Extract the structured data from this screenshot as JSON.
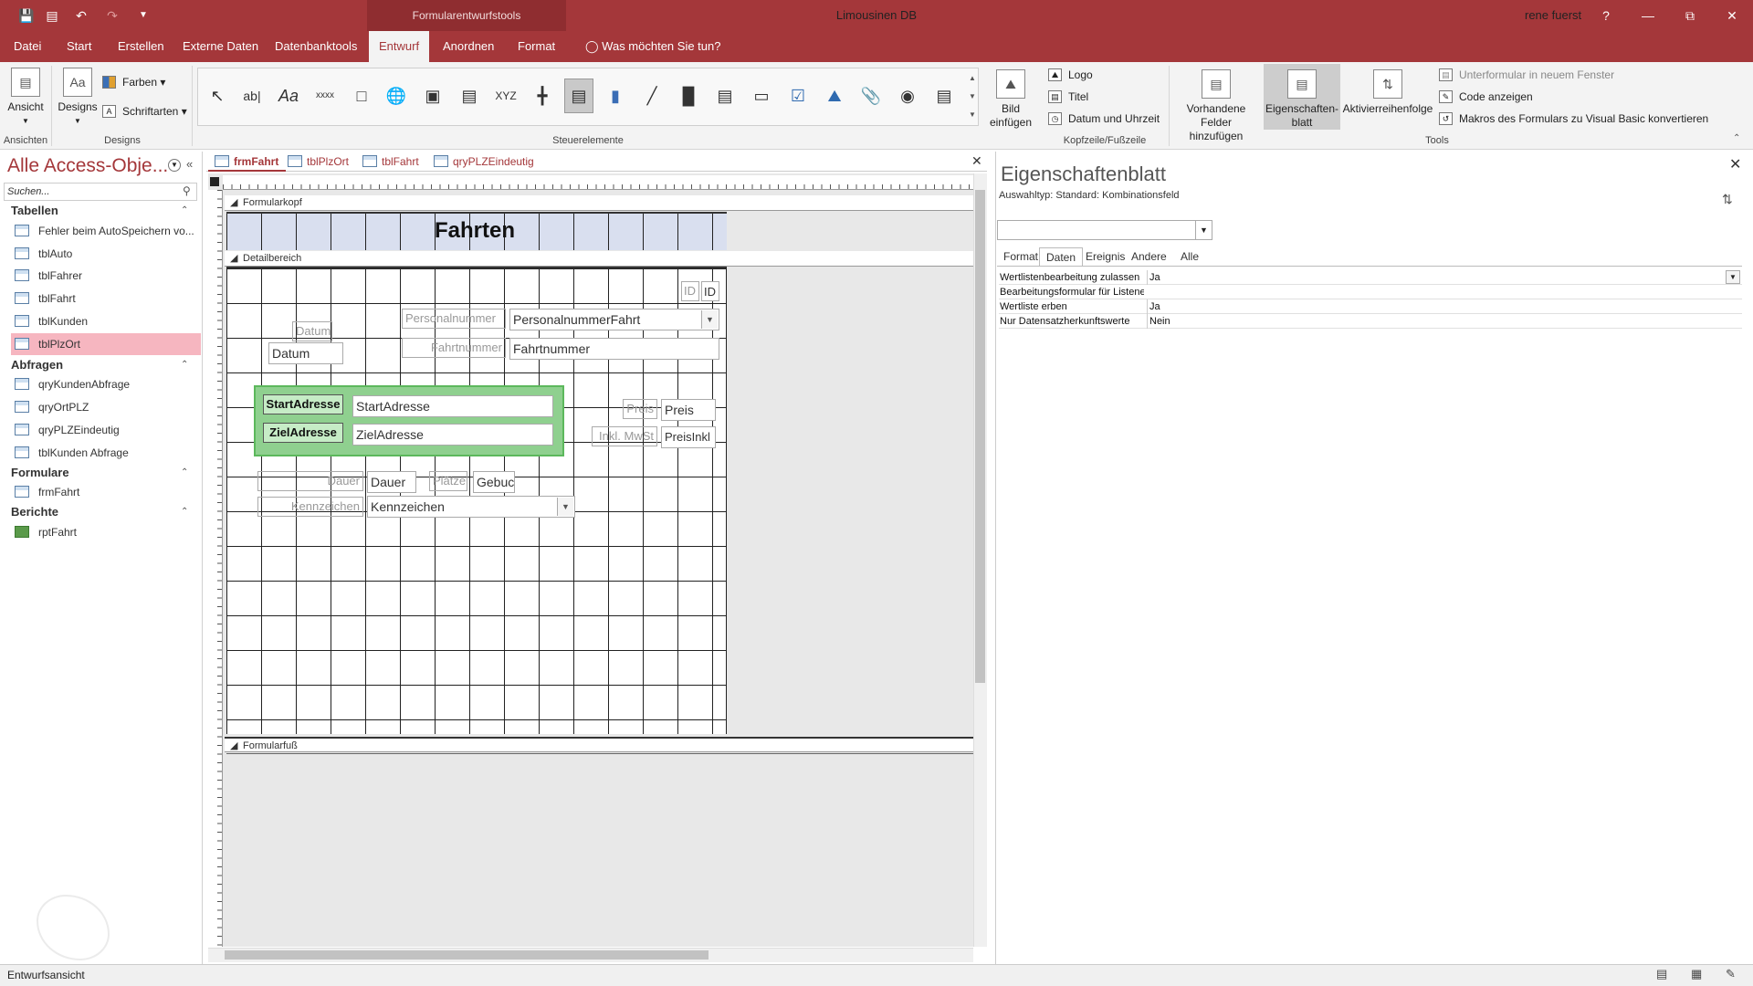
{
  "app": {
    "context_tab": "Formularentwurfstools",
    "title": "Limousinen DB",
    "user": "rene fuerst",
    "help": "?"
  },
  "ribbon_tabs": [
    "Datei",
    "Start",
    "Erstellen",
    "Externe Daten",
    "Datenbanktools",
    "Entwurf",
    "Anordnen",
    "Format"
  ],
  "tell_me": "Was möchten Sie tun?",
  "ribbon": {
    "ansicht": "Ansicht",
    "ansichten_group": "Ansichten",
    "designs": "Designs",
    "farben": "Farben",
    "schriftarten": "Schriftarten",
    "designs_group": "Designs",
    "steuerelemente_group": "Steuerelemente",
    "controls_xyz": "XYZ",
    "controls_abl": "ab|",
    "controls_aa": "Aa",
    "controls_xxxx": "xxxx",
    "bild_einfuegen_1": "Bild",
    "bild_einfuegen_2": "einfügen",
    "logo": "Logo",
    "titel": "Titel",
    "datum_uhrzeit": "Datum und Uhrzeit",
    "kopfzeile_group": "Kopfzeile/Fußzeile",
    "vorhandene_1": "Vorhandene",
    "vorhandene_2": "Felder hinzufügen",
    "eigenschaften_1": "Eigenschaften-",
    "eigenschaften_2": "blatt",
    "aktivierung": "Aktivierreihenfolge",
    "unterformular": "Unterformular in neuem Fenster",
    "code_anzeigen": "Code anzeigen",
    "makros": "Makros des Formulars zu Visual Basic konvertieren",
    "tools_group": "Tools"
  },
  "nav": {
    "title": "Alle Access-Obje...",
    "search_placeholder": "Suchen...",
    "sections": [
      {
        "label": "Tabellen",
        "items": [
          "Fehler beim AutoSpeichern vo...",
          "tblAuto",
          "tblFahrer",
          "tblFahrt",
          "tblKunden",
          "tblPlzOrt"
        ]
      },
      {
        "label": "Abfragen",
        "items": [
          "qryKundenAbfrage",
          "qryOrtPLZ",
          "qryPLZEindeutig",
          "tblKunden Abfrage"
        ]
      },
      {
        "label": "Formulare",
        "items": [
          "frmFahrt"
        ]
      },
      {
        "label": "Berichte",
        "items": [
          "rptFahrt"
        ]
      }
    ]
  },
  "doc_tabs": [
    "frmFahrt",
    "tblPlzOrt",
    "tblFahrt",
    "qryPLZEindeutig"
  ],
  "design": {
    "sec_header": "Formularkopf",
    "sec_detail": "Detailbereich",
    "sec_footer": "Formularfuß",
    "form_title": "Fahrten",
    "id_label": "ID",
    "id_field": "ID",
    "datum_label": "Datum",
    "datum_field": "Datum",
    "personal_label": "Personalnummer",
    "personal_field": "PersonalnummerFahrt",
    "fahrt_label": "Fahrtnummer",
    "fahrt_field": "Fahrtnummer",
    "start_label": "StartAdresse",
    "start_field": "StartAdresse",
    "ziel_label": "ZielAdresse",
    "ziel_field": "ZielAdresse",
    "preis_label": "Preis",
    "preis_field": "Preis",
    "inkl_label": "Inkl. MwSt",
    "inkl_field": "PreisInkl",
    "dauer_label": "Dauer",
    "dauer_field": "Dauer",
    "plaetze_label": "Plätze",
    "gebucht_field": "Gebucl",
    "kennzeichen_label": "Kennzeichen",
    "kennzeichen_field": "Kennzeichen"
  },
  "props": {
    "title": "Eigenschaftenblatt",
    "auswahltyp": "Auswahltyp:  Standard: Kombinationsfeld",
    "tabs": [
      "Format",
      "Daten",
      "Ereignis",
      "Andere",
      "Alle"
    ],
    "rows": [
      {
        "k": "Wertlistenbearbeitung zulassen",
        "v": "Ja"
      },
      {
        "k": "Bearbeitungsformular für Listenelemente",
        "v": ""
      },
      {
        "k": "Wertliste erben",
        "v": "Ja"
      },
      {
        "k": "Nur Datensatzherkunftswerte",
        "v": "Nein"
      }
    ]
  },
  "status": "Entwurfsansicht",
  "colors": {
    "accent": "#a4373a",
    "nav_selected": "#f6b6c0",
    "form_header": "#d9dfef",
    "selection_green": "#8fd08f"
  }
}
